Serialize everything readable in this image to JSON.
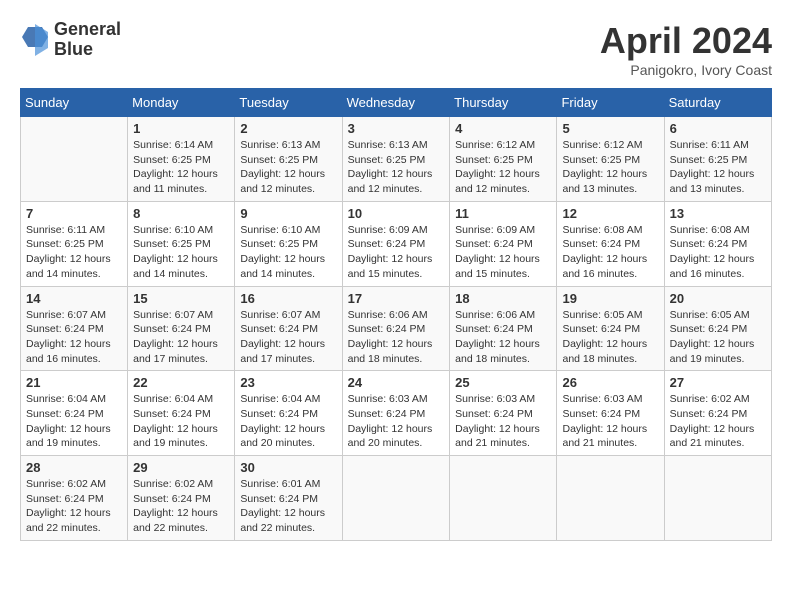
{
  "header": {
    "logo_line1": "General",
    "logo_line2": "Blue",
    "month_title": "April 2024",
    "location": "Panigokro, Ivory Coast"
  },
  "calendar": {
    "days_of_week": [
      "Sunday",
      "Monday",
      "Tuesday",
      "Wednesday",
      "Thursday",
      "Friday",
      "Saturday"
    ],
    "weeks": [
      [
        {
          "day": "",
          "info": ""
        },
        {
          "day": "1",
          "info": "Sunrise: 6:14 AM\nSunset: 6:25 PM\nDaylight: 12 hours\nand 11 minutes."
        },
        {
          "day": "2",
          "info": "Sunrise: 6:13 AM\nSunset: 6:25 PM\nDaylight: 12 hours\nand 12 minutes."
        },
        {
          "day": "3",
          "info": "Sunrise: 6:13 AM\nSunset: 6:25 PM\nDaylight: 12 hours\nand 12 minutes."
        },
        {
          "day": "4",
          "info": "Sunrise: 6:12 AM\nSunset: 6:25 PM\nDaylight: 12 hours\nand 12 minutes."
        },
        {
          "day": "5",
          "info": "Sunrise: 6:12 AM\nSunset: 6:25 PM\nDaylight: 12 hours\nand 13 minutes."
        },
        {
          "day": "6",
          "info": "Sunrise: 6:11 AM\nSunset: 6:25 PM\nDaylight: 12 hours\nand 13 minutes."
        }
      ],
      [
        {
          "day": "7",
          "info": "Sunrise: 6:11 AM\nSunset: 6:25 PM\nDaylight: 12 hours\nand 14 minutes."
        },
        {
          "day": "8",
          "info": "Sunrise: 6:10 AM\nSunset: 6:25 PM\nDaylight: 12 hours\nand 14 minutes."
        },
        {
          "day": "9",
          "info": "Sunrise: 6:10 AM\nSunset: 6:25 PM\nDaylight: 12 hours\nand 14 minutes."
        },
        {
          "day": "10",
          "info": "Sunrise: 6:09 AM\nSunset: 6:24 PM\nDaylight: 12 hours\nand 15 minutes."
        },
        {
          "day": "11",
          "info": "Sunrise: 6:09 AM\nSunset: 6:24 PM\nDaylight: 12 hours\nand 15 minutes."
        },
        {
          "day": "12",
          "info": "Sunrise: 6:08 AM\nSunset: 6:24 PM\nDaylight: 12 hours\nand 16 minutes."
        },
        {
          "day": "13",
          "info": "Sunrise: 6:08 AM\nSunset: 6:24 PM\nDaylight: 12 hours\nand 16 minutes."
        }
      ],
      [
        {
          "day": "14",
          "info": "Sunrise: 6:07 AM\nSunset: 6:24 PM\nDaylight: 12 hours\nand 16 minutes."
        },
        {
          "day": "15",
          "info": "Sunrise: 6:07 AM\nSunset: 6:24 PM\nDaylight: 12 hours\nand 17 minutes."
        },
        {
          "day": "16",
          "info": "Sunrise: 6:07 AM\nSunset: 6:24 PM\nDaylight: 12 hours\nand 17 minutes."
        },
        {
          "day": "17",
          "info": "Sunrise: 6:06 AM\nSunset: 6:24 PM\nDaylight: 12 hours\nand 18 minutes."
        },
        {
          "day": "18",
          "info": "Sunrise: 6:06 AM\nSunset: 6:24 PM\nDaylight: 12 hours\nand 18 minutes."
        },
        {
          "day": "19",
          "info": "Sunrise: 6:05 AM\nSunset: 6:24 PM\nDaylight: 12 hours\nand 18 minutes."
        },
        {
          "day": "20",
          "info": "Sunrise: 6:05 AM\nSunset: 6:24 PM\nDaylight: 12 hours\nand 19 minutes."
        }
      ],
      [
        {
          "day": "21",
          "info": "Sunrise: 6:04 AM\nSunset: 6:24 PM\nDaylight: 12 hours\nand 19 minutes."
        },
        {
          "day": "22",
          "info": "Sunrise: 6:04 AM\nSunset: 6:24 PM\nDaylight: 12 hours\nand 19 minutes."
        },
        {
          "day": "23",
          "info": "Sunrise: 6:04 AM\nSunset: 6:24 PM\nDaylight: 12 hours\nand 20 minutes."
        },
        {
          "day": "24",
          "info": "Sunrise: 6:03 AM\nSunset: 6:24 PM\nDaylight: 12 hours\nand 20 minutes."
        },
        {
          "day": "25",
          "info": "Sunrise: 6:03 AM\nSunset: 6:24 PM\nDaylight: 12 hours\nand 21 minutes."
        },
        {
          "day": "26",
          "info": "Sunrise: 6:03 AM\nSunset: 6:24 PM\nDaylight: 12 hours\nand 21 minutes."
        },
        {
          "day": "27",
          "info": "Sunrise: 6:02 AM\nSunset: 6:24 PM\nDaylight: 12 hours\nand 21 minutes."
        }
      ],
      [
        {
          "day": "28",
          "info": "Sunrise: 6:02 AM\nSunset: 6:24 PM\nDaylight: 12 hours\nand 22 minutes."
        },
        {
          "day": "29",
          "info": "Sunrise: 6:02 AM\nSunset: 6:24 PM\nDaylight: 12 hours\nand 22 minutes."
        },
        {
          "day": "30",
          "info": "Sunrise: 6:01 AM\nSunset: 6:24 PM\nDaylight: 12 hours\nand 22 minutes."
        },
        {
          "day": "",
          "info": ""
        },
        {
          "day": "",
          "info": ""
        },
        {
          "day": "",
          "info": ""
        },
        {
          "day": "",
          "info": ""
        }
      ]
    ]
  }
}
